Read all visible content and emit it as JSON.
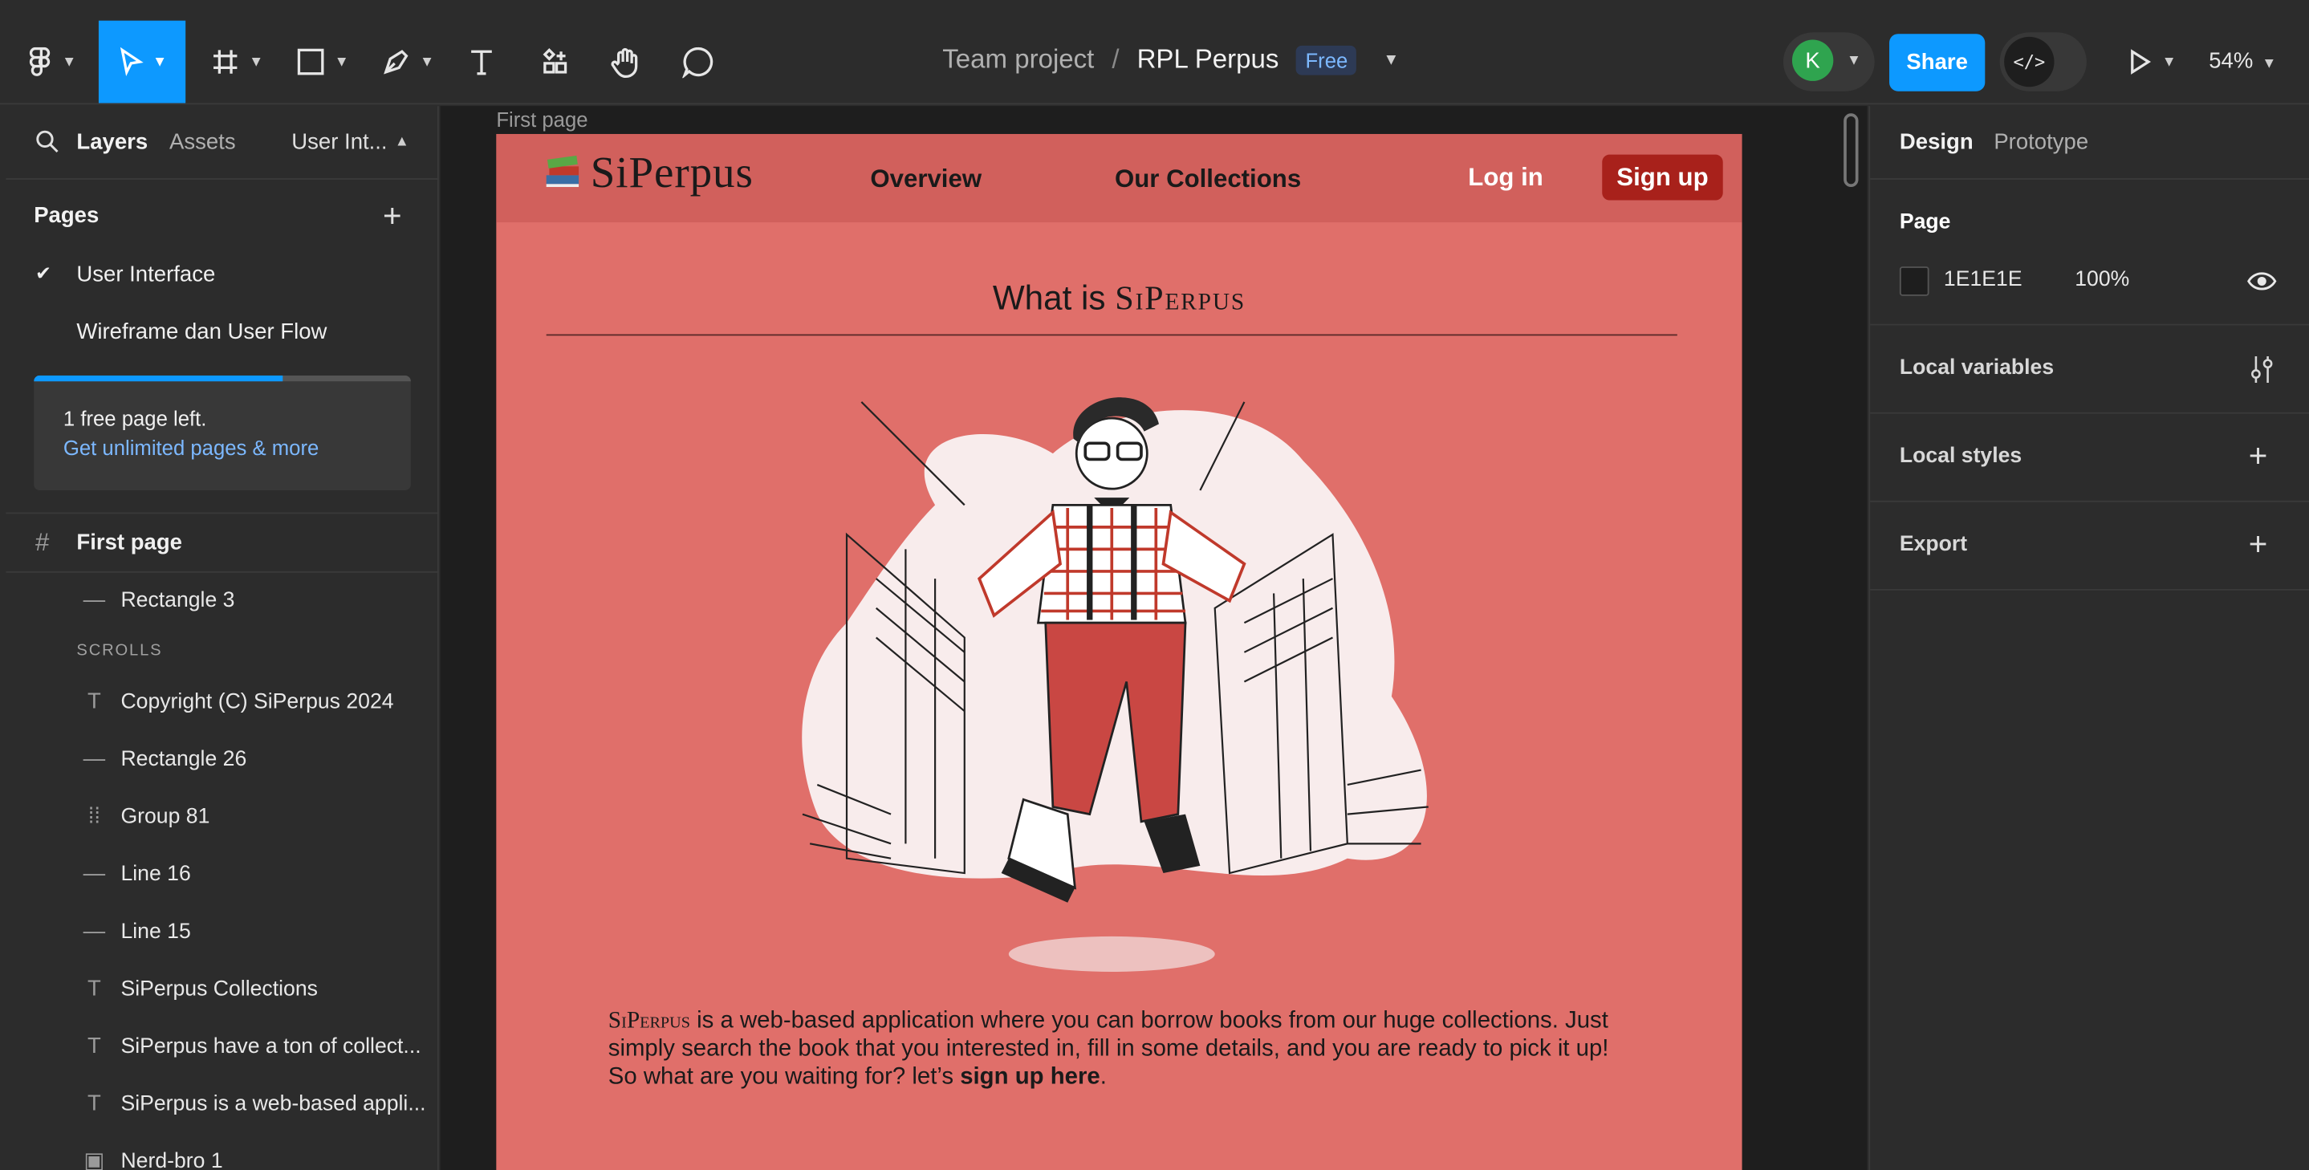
{
  "toolbar": {
    "team": "Team project",
    "separator": "/",
    "file": "RPL Perpus",
    "plan_badge": "Free",
    "avatar_initial": "K",
    "share_label": "Share",
    "dev_mode_glyph": "</>",
    "zoom": "54%"
  },
  "left_panel": {
    "tabs": {
      "layers": "Layers",
      "assets": "Assets",
      "page_switch": "User Int..."
    },
    "pages_title": "Pages",
    "pages": [
      "User Interface",
      "Wireframe dan User Flow"
    ],
    "free_card": {
      "line1": "1 free page left.",
      "line2": "Get unlimited pages & more",
      "used_fraction": 0.66
    },
    "frame_name": "First page",
    "layers": [
      {
        "icon": "line-icon",
        "name": "Rectangle 3"
      },
      {
        "icon": "text-icon",
        "name": "Copyright (C) SiPerpus 2024"
      },
      {
        "icon": "line-icon",
        "name": "Rectangle 26"
      },
      {
        "icon": "group-icon",
        "name": "Group 81"
      },
      {
        "icon": "line-icon",
        "name": "Line 16"
      },
      {
        "icon": "line-icon",
        "name": "Line 15"
      },
      {
        "icon": "text-icon",
        "name": "SiPerpus Collections"
      },
      {
        "icon": "text-icon",
        "name": "SiPerpus have a ton of collect..."
      },
      {
        "icon": "text-icon",
        "name": "SiPerpus is a web-based appli..."
      },
      {
        "icon": "image-icon",
        "name": "Nerd-bro 1"
      }
    ],
    "scrolls_label": "SCROLLS"
  },
  "canvas": {
    "frame_label": "First page",
    "site": {
      "logo": "SiPerpus",
      "nav": [
        "Overview",
        "Our Collections"
      ],
      "login": "Log in",
      "signup": "Sign up",
      "heading_prefix": "What is ",
      "heading_brand": "SiPerpus",
      "desc_brand": "SiPerpus",
      "desc_text": " is a web-based application where you can borrow books from our huge collections. Just simply search the book that you interested in, fill in some details, and you are ready to pick it up! So what are you waiting for? let’s ",
      "desc_link": "sign up here",
      "desc_end": "."
    }
  },
  "right_panel": {
    "tabs": [
      "Design",
      "Prototype"
    ],
    "page_section": "Page",
    "page_color": "1E1E1E",
    "page_opacity": "100%",
    "sections": [
      "Local variables",
      "Local styles",
      "Export"
    ]
  },
  "colors": {
    "accent": "#0d99ff",
    "site_bg": "#e06f6a",
    "site_nav": "#d1605c",
    "signup_bg": "#a8211b"
  }
}
